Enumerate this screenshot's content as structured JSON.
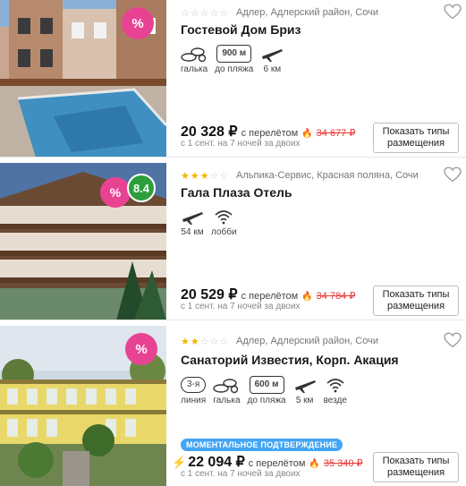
{
  "hotels": [
    {
      "stars_on": "",
      "stars_off": "☆☆☆☆☆",
      "location": "Адлер, Адлерский район, Сочи",
      "name": "Гостевой Дом Бриз",
      "features": {
        "beach_type": "галька",
        "distance_value": "900 м",
        "distance_label": "до пляжа",
        "airport": "6 км"
      },
      "price": "20 328 ₽",
      "price_suffix": "с перелётом",
      "old_price": "34 677 ₽",
      "dates": "с 1 сент. на 7 ночей за двоих",
      "button": "Показать типы размещения",
      "sale_icon": "%"
    },
    {
      "stars_on": "★★★",
      "stars_off": "☆☆",
      "location": "Альпика-Сервис, Красная поляна, Сочи",
      "name": "Гала Плаза Отель",
      "rating": "8.4",
      "features": {
        "airport": "54 км",
        "wifi": "лобби"
      },
      "price": "20 529 ₽",
      "price_suffix": "с перелётом",
      "old_price": "34 784 ₽",
      "dates": "с 1 сент. на 7 ночей за двоих",
      "button": "Показать типы размещения",
      "sale_icon": "%"
    },
    {
      "stars_on": "★★",
      "stars_off": "☆☆☆",
      "location": "Адлер, Адлерский район, Сочи",
      "name": "Санаторий Известия, Корп. Акация",
      "features": {
        "line_value": "3-я",
        "line_label": "линия",
        "beach_type": "галька",
        "distance_value": "600 м",
        "distance_label": "до пляжа",
        "airport": "5 км",
        "wifi": "везде"
      },
      "instant": "МОМЕНТАЛЬНОЕ ПОДТВЕРЖДЕНИЕ",
      "price": "22 094 ₽",
      "price_suffix": "с перелётом",
      "old_price": "35 340 ₽",
      "dates": "с 1 сент. на 7 ночей за двоих",
      "button": "Показать типы размещения",
      "sale_icon": "%"
    }
  ]
}
